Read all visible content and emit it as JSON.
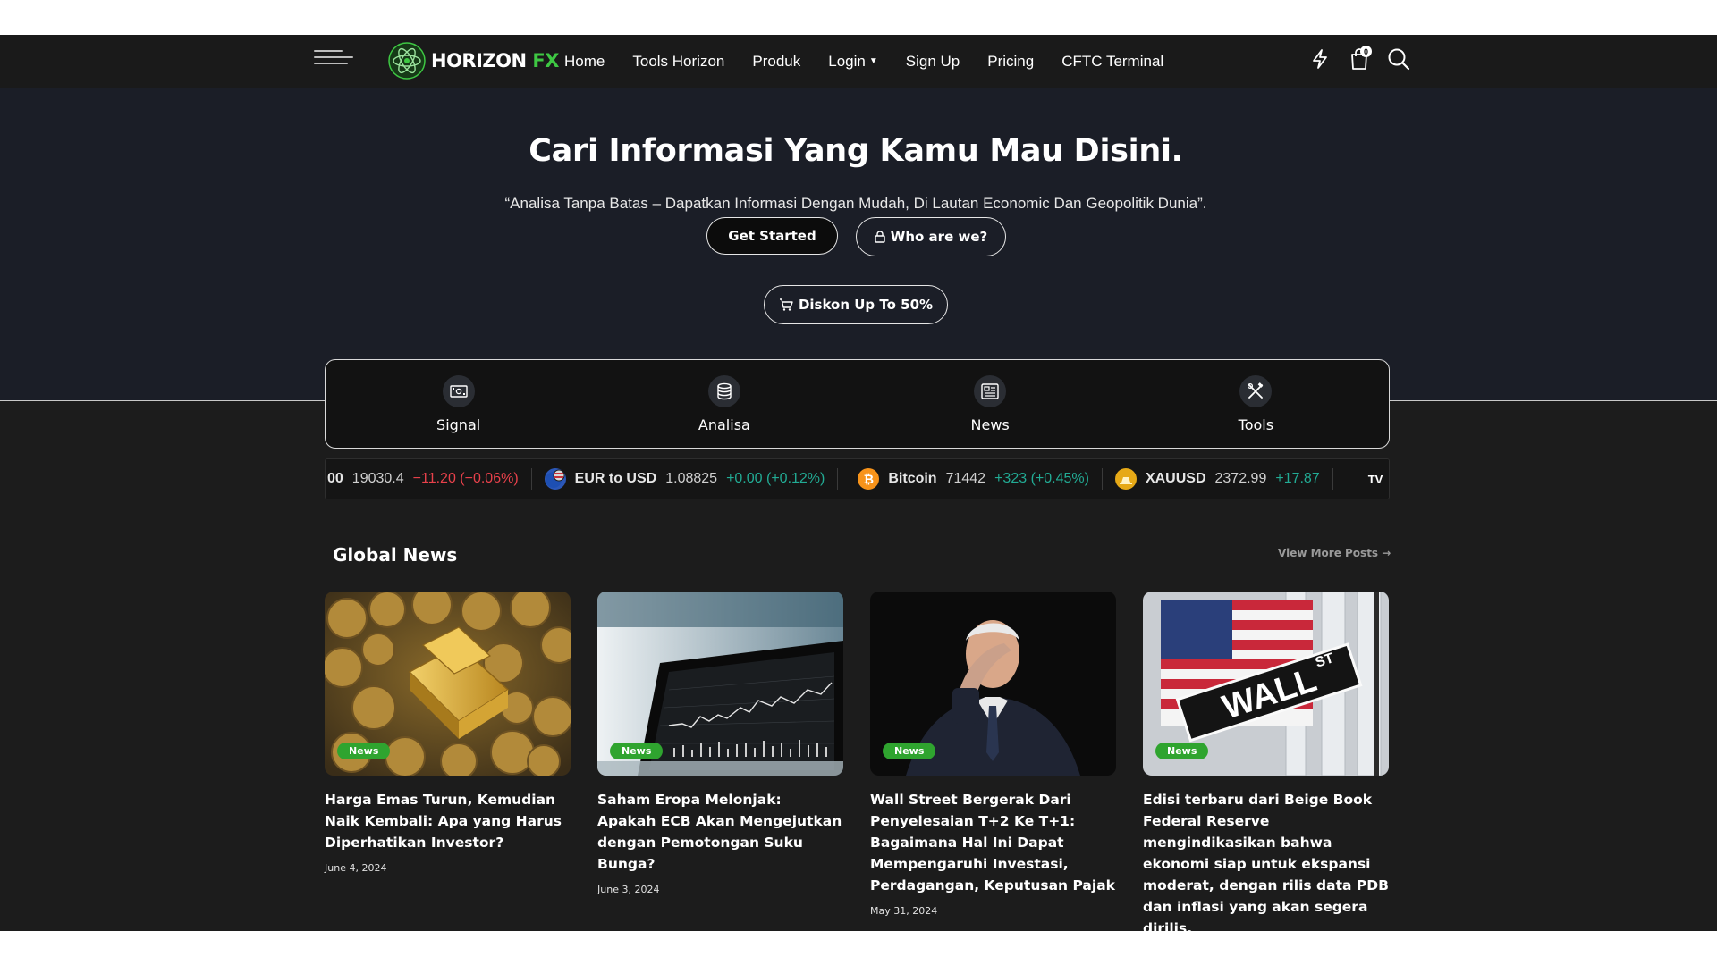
{
  "header": {
    "logo_text": "HORIZON",
    "logo_accent": "FX",
    "nav": [
      {
        "label": "Home"
      },
      {
        "label": "Tools Horizon"
      },
      {
        "label": "Produk"
      },
      {
        "label": "Login"
      },
      {
        "label": "Sign Up"
      },
      {
        "label": "Pricing"
      },
      {
        "label": "CFTC Terminal"
      }
    ],
    "cart_count": "0",
    "icons": [
      "menu-icon",
      "lightning-icon",
      "cart-icon",
      "search-icon"
    ]
  },
  "hero": {
    "title": "Cari Informasi Yang Kamu Mau Disini.",
    "subtitle": "“Analisa Tanpa Batas – Dapatkan Informasi Dengan Mudah, Di Lautan Economic Dan Geopolitik Dunia”.",
    "btn_start": "Get Started",
    "btn_who": "Who are we?",
    "btn_diskon": "Diskon Up To 50%"
  },
  "categories": [
    {
      "label": "Signal",
      "icon": "money-icon"
    },
    {
      "label": "Analisa",
      "icon": "database-icon"
    },
    {
      "label": "News",
      "icon": "newspaper-icon"
    },
    {
      "label": "Tools",
      "icon": "tools-icon"
    }
  ],
  "ticker": [
    {
      "name": "00",
      "price": "19030.4",
      "change": "−11.20 (−0.06%)",
      "dir": "down"
    },
    {
      "name": "EUR to USD",
      "price": "1.08825",
      "change": "+0.00 (+0.12%)",
      "dir": "up"
    },
    {
      "name": "Bitcoin",
      "price": "71442",
      "change": "+323 (+0.45%)",
      "dir": "up"
    },
    {
      "name": "XAUUSD",
      "price": "2372.99",
      "change": "+17.87",
      "dir": "up"
    }
  ],
  "ticker_brand": "TV",
  "global_news": {
    "title": "Global News",
    "more": "View More Posts →",
    "posts": [
      {
        "badge": "News",
        "title": "Harga Emas Turun, Kemudian Naik Kembali: Apa yang Harus Diperhatikan Investor?",
        "date": "June 4, 2024"
      },
      {
        "badge": "News",
        "title": "Saham Eropa Melonjak: Apakah ECB Akan Mengejutkan dengan Pemotongan Suku Bunga?",
        "date": "June 3, 2024"
      },
      {
        "badge": "News",
        "title": "Wall Street Bergerak Dari Penyelesaian T+2 Ke T+1: Bagaimana Hal Ini Dapat Mempengaruhi Investasi, Perdagangan, Keputusan Pajak",
        "date": "May 31, 2024"
      },
      {
        "badge": "News",
        "title": "Edisi terbaru dari Beige Book Federal Reserve mengindikasikan bahwa ekonomi siap untuk ekspansi moderat, dengan rilis data PDB dan inflasi yang akan segera dirilis.",
        "date": ""
      }
    ]
  },
  "colors": {
    "accent_green": "#3ec843",
    "badge_green": "#2fa42f",
    "down": "#e8414b",
    "up": "#22ab94"
  }
}
